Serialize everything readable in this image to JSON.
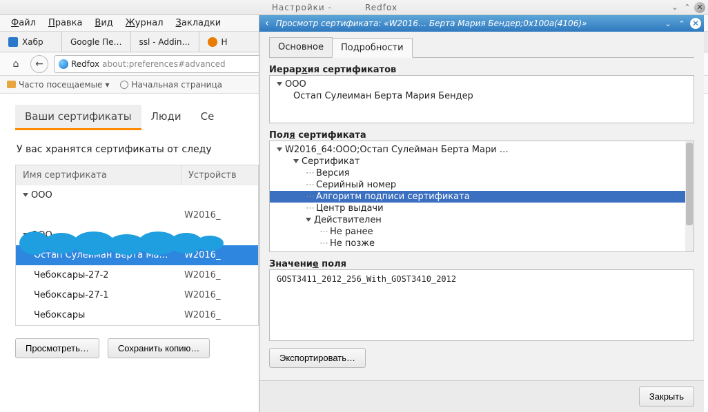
{
  "parent_window": {
    "title_left": "Настройки -",
    "title_right": "Redfox"
  },
  "menubar": [
    "Файл",
    "Правка",
    "Вид",
    "Журнал",
    "Закладки"
  ],
  "browser_tabs": [
    {
      "label": "Хабр"
    },
    {
      "label": "Google Пе…"
    },
    {
      "label": "ssl - Addin…"
    },
    {
      "label": "Н"
    }
  ],
  "urlbar": {
    "host": "Redfox",
    "path": "about:preferences#advanced"
  },
  "bookmarks": [
    {
      "label": "Часто посещаемые"
    },
    {
      "label": "Начальная страница"
    }
  ],
  "cert_manager": {
    "tabs": [
      "Ваши сертификаты",
      "Люди",
      "Се"
    ],
    "active_tab": 0,
    "desc": "У вас хранятся сертификаты от следу",
    "columns": [
      "Имя сертификата",
      "Устройств"
    ],
    "rows": [
      {
        "type": "group",
        "name": "ООО",
        "dev": ""
      },
      {
        "type": "item",
        "name": "",
        "dev": "W2016_"
      },
      {
        "type": "group",
        "name": "ООО",
        "dev": ""
      },
      {
        "type": "item",
        "name": "Остап Сулейман Берта Ма…",
        "dev": "W2016_",
        "selected": true
      },
      {
        "type": "item",
        "name": "Чебоксары-27-2",
        "dev": "W2016_"
      },
      {
        "type": "item",
        "name": "Чебоксары-27-1",
        "dev": "W2016_"
      },
      {
        "type": "item",
        "name": "Чебоксары",
        "dev": "W2016_"
      }
    ],
    "buttons": {
      "view": "Просмотреть…",
      "backup": "Сохранить копию…"
    }
  },
  "modal": {
    "title": "Просмотр сертификата: «W2016… Берта Мария Бендер;0x100a(4106)»",
    "tabs": {
      "main": "Основное",
      "details": "Подробности"
    },
    "hierarchy_label": "Иерархия сертификатов",
    "hierarchy": {
      "root": "ООО",
      "leaf": "Остап Сулеиман Берта Мария Бендер"
    },
    "fields_label": "Поля сертификата",
    "fields": {
      "root": "W2016_64:ООО;Остап Сулейман Берта Мари   …",
      "cert": "Сертификат",
      "version": "Версия",
      "serial": "Серийный номер",
      "sigalg": "Алгоритм подписи сертификата",
      "issuer": "Центр выдачи",
      "validity": "Действителен",
      "notbefore": "Не ранее",
      "notafter": "Не позже"
    },
    "value_label": "Значение поля",
    "value": "GOST3411_2012_256_With_GOST3410_2012",
    "export_btn": "Экспортировать…",
    "close_btn": "Закрыть"
  }
}
